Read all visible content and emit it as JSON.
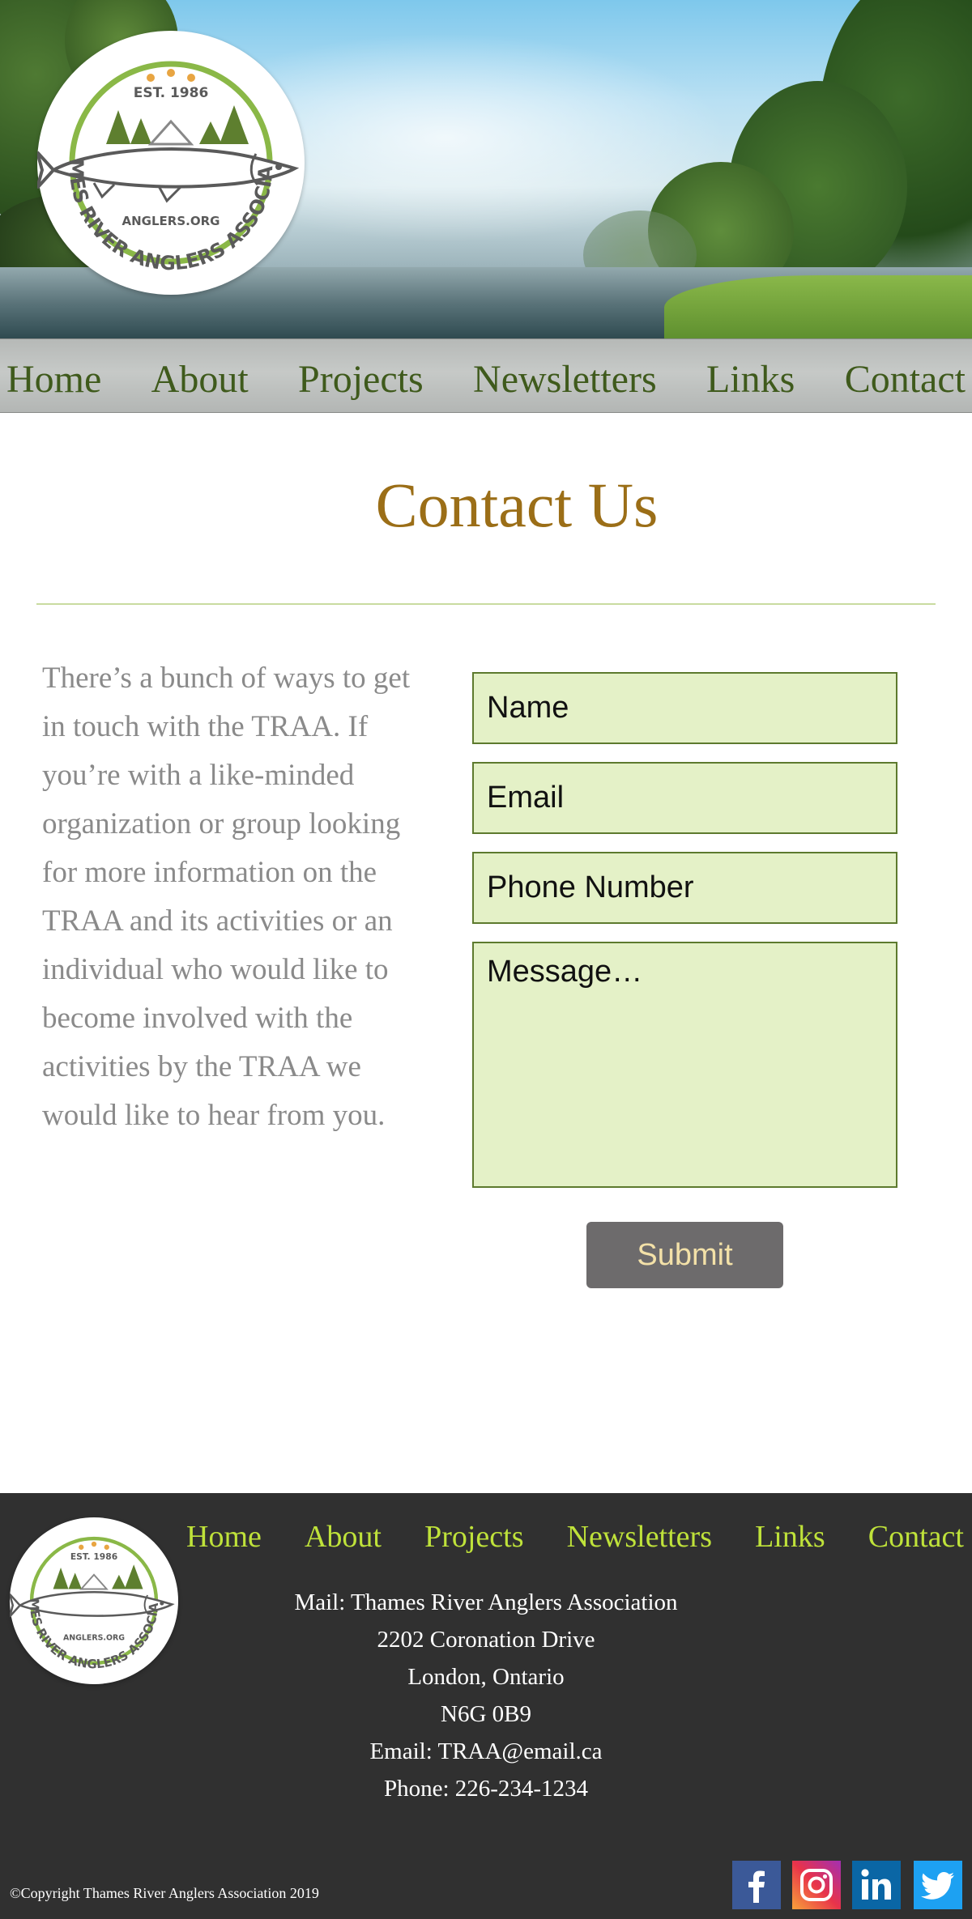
{
  "logo": {
    "est": "EST. 1986",
    "site": "ANGLERS.ORG",
    "ring_text": "THAMES RIVER ANGLERS ASSOCIATION"
  },
  "nav": {
    "items": [
      "Home",
      "About",
      "Projects",
      "Newsletters",
      "Links",
      "Contact"
    ]
  },
  "page": {
    "title": "Contact Us",
    "intro": "There’s a bunch of ways to get in touch with the TRAA. If you’re with a like-minded organization or group looking for more information on the TRAA and its activities or an individual who would like to become involved with the activities by the TRAA we would like to hear from you."
  },
  "form": {
    "name_placeholder": "Name",
    "email_placeholder": "Email",
    "phone_placeholder": "Phone Number",
    "message_placeholder": "Message…",
    "submit_label": "Submit"
  },
  "footer": {
    "nav": [
      "Home",
      "About",
      "Projects",
      "Newsletters",
      "Links",
      "Contact"
    ],
    "address": [
      "Mail: Thames River Anglers Association",
      "2202 Coronation Drive",
      "London, Ontario",
      "N6G 0B9",
      "Email: TRAA@email.ca",
      "Phone: 226-234-1234"
    ],
    "copyright": "©Copyright Thames River Anglers Association 2019",
    "social": [
      "facebook-icon",
      "instagram-icon",
      "linkedin-icon",
      "twitter-icon"
    ]
  },
  "colors": {
    "nav_text": "#3f5a1c",
    "title": "#9b6e17",
    "field_bg": "#e4f1c7",
    "field_border": "#5d7a2e",
    "footer_bg": "#303030",
    "footer_link": "#bfe23a",
    "submit_bg": "#6d6b6c",
    "submit_text": "#f3e1a8"
  }
}
